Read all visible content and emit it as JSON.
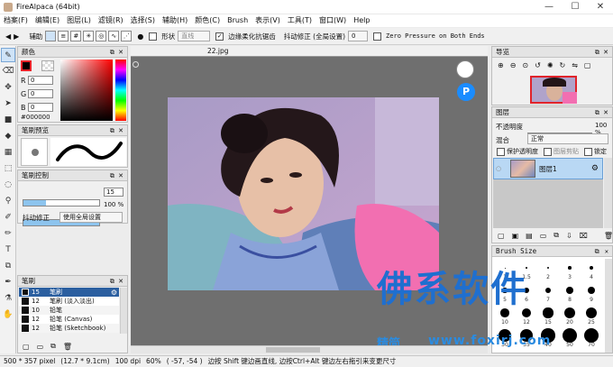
{
  "window": {
    "title": "FireAlpaca (64bit)"
  },
  "menu": [
    "档案(F)",
    "编辑(E)",
    "图层(L)",
    "滤镜(R)",
    "选择(S)",
    "辅助(H)",
    "颜色(C)",
    "Brush",
    "表示(V)",
    "工具(T)",
    "窗口(W)",
    "Help"
  ],
  "toolbar": {
    "snap_label": "辅助",
    "shape_label": "形状",
    "shape_value": "直线",
    "aa_label": "边缘柔化抗锯齿",
    "stabilizer_label": "抖动修正 (全局设置)",
    "stabilizer_value": "0",
    "zero_pressure_label": "Zero Pressure on Both Ends"
  },
  "color_panel": {
    "title": "颜色",
    "r_label": "R",
    "r_value": "0",
    "g_label": "G",
    "g_value": "0",
    "b_label": "B",
    "b_value": "0",
    "hex": "#000000",
    "primary": "#000000",
    "accent": "#e8232a"
  },
  "brush_preview_panel": {
    "title": "笔刷预览"
  },
  "brush_control_panel": {
    "title": "笔刷控制",
    "size_value": "15",
    "opacity_value": "100 %",
    "stabilizer_label": "抖动修正",
    "stabilizer_value": "使用全局设置"
  },
  "brush_panel": {
    "title": "笔刷",
    "items": [
      {
        "size": "15",
        "name": "笔刷"
      },
      {
        "size": "12",
        "name": "笔刷 (淡入淡出)"
      },
      {
        "size": "10",
        "name": "铅笔"
      },
      {
        "size": "12",
        "name": "铅笔 (Canvas)"
      },
      {
        "size": "12",
        "name": "铅笔 (Sketchbook)"
      }
    ]
  },
  "canvas": {
    "tab": "22.jpg"
  },
  "navigator_panel": {
    "title": "导览"
  },
  "layer_panel": {
    "title": "图层",
    "opacity_label": "不透明度",
    "opacity_value": "100 %",
    "blend_label": "混合",
    "blend_value": "正常",
    "protect_label": "保护透明度",
    "clip_label": "图层剪贴",
    "lock_label": "锁定",
    "layer_name": "图层1"
  },
  "brush_size_panel": {
    "title": "Brush Size",
    "sizes": [
      "1",
      "1.5",
      "2",
      "3",
      "4",
      "5",
      "6",
      "7",
      "8",
      "9",
      "10",
      "12",
      "15",
      "20",
      "25",
      "30",
      "35",
      "40",
      "50",
      "70"
    ]
  },
  "status": {
    "size": "500 * 357 pixel",
    "cm": "(12.7 * 9.1cm)",
    "dpi": "100 dpi",
    "zoom": "60%",
    "coords": "( -57, -54 )",
    "hint": "边按 Shift 键边画直线, 边按Ctrl+Alt 键边左右拖引来变更尺寸"
  },
  "watermark": {
    "main": "佛系软件",
    "sub_left": "精简",
    "sub_right": "www.foxirj.com"
  }
}
